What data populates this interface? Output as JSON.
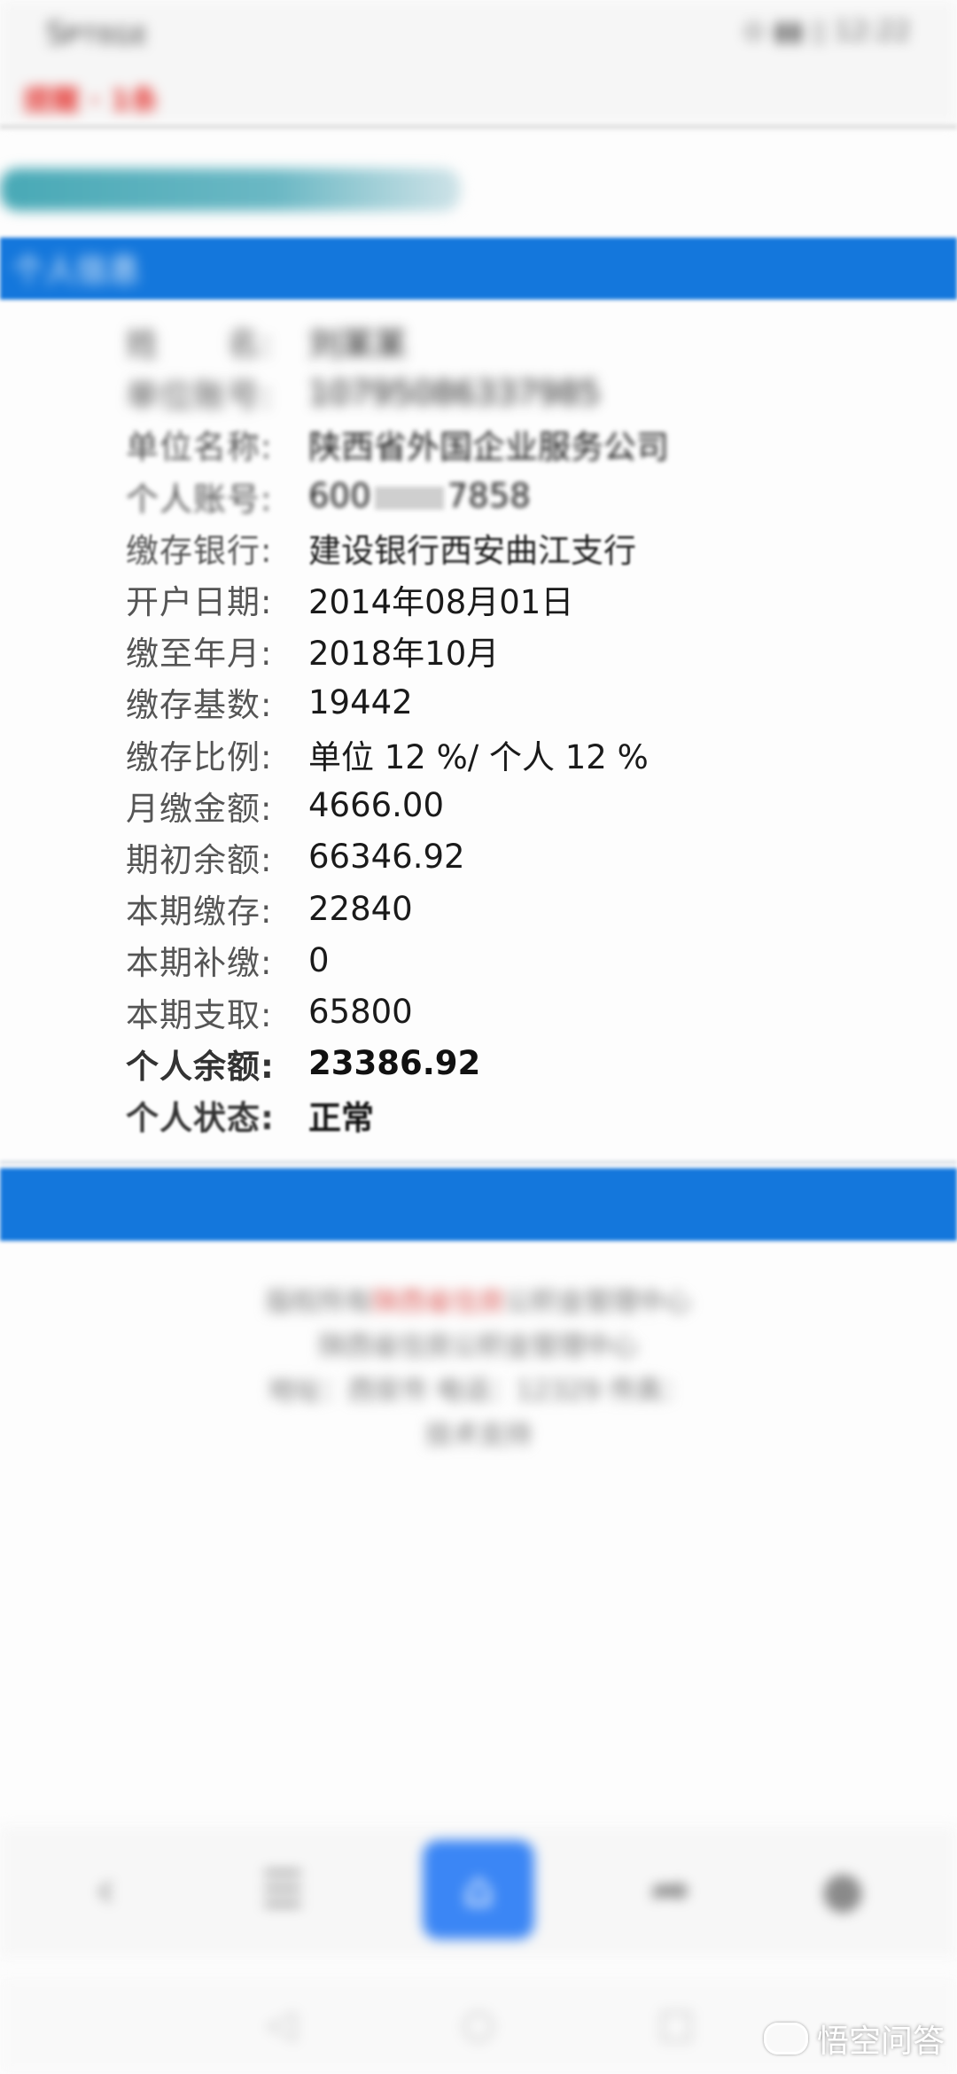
{
  "status_bar": {
    "left_text": "Sᴘᴛᴇɢᴇ",
    "right_text": "⊙ ▮▮ ▯ 12:22",
    "red_text": "提醒 · 1条"
  },
  "top_link": "",
  "section_title": "个人信息",
  "info_rows": [
    {
      "label": "姓　　名:",
      "value": "刘某某"
    },
    {
      "label": "单位账号:",
      "value": "10795086337985"
    },
    {
      "label": "单位名称:",
      "value": "陕西省外国企业服务公司"
    },
    {
      "label": "个人账号:",
      "value_prefix": "600",
      "value_suffix": "7858"
    },
    {
      "label": "缴存银行:",
      "value": "建设银行西安曲江支行"
    },
    {
      "label": "开户日期:",
      "value": "2014年08月01日"
    },
    {
      "label": "缴至年月:",
      "value": "2018年10月"
    },
    {
      "label": "缴存基数:",
      "value": "19442"
    },
    {
      "label": "缴存比例:",
      "value": "单位 12 %/ 个人 12 %"
    },
    {
      "label": "月缴金额:",
      "value": "4666.00"
    },
    {
      "label": "期初余额:",
      "value": "66346.92"
    },
    {
      "label": "本期缴存:",
      "value": "22840"
    },
    {
      "label": "本期补缴:",
      "value": "0"
    },
    {
      "label": "本期支取:",
      "value": "65800"
    },
    {
      "label": "个人余额:",
      "value": "23386.92"
    },
    {
      "label": "个人状态:",
      "value": "正常"
    }
  ],
  "footer": {
    "line1_a": "版权所有",
    "line1_red": "陕西省住房",
    "line1_b": "公积金管理中心",
    "line2": "陕西省住房公积金管理中心",
    "line3": "地址：西安市 电话：12329 传真：",
    "line4": "技术支持"
  },
  "toolbar": {
    "back_icon": "‹",
    "menu_icon": "☰",
    "home_icon": "⌂",
    "share_icon": "➦",
    "profile_icon": "●"
  },
  "navbar": {
    "back": "◁",
    "home": "○",
    "recent": "□"
  },
  "watermark": {
    "text": "悟空问答"
  }
}
